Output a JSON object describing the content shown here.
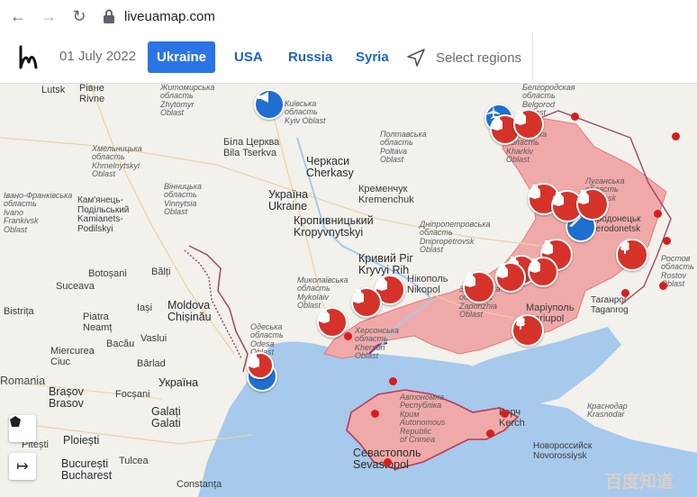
{
  "browser": {
    "url": "liveuamap.com"
  },
  "header": {
    "date": "01 July 2022",
    "tabs": [
      {
        "label": "Ukraine",
        "active": true
      },
      {
        "label": "USA",
        "active": false
      },
      {
        "label": "Russia",
        "active": false
      },
      {
        "label": "Syria",
        "active": false
      }
    ],
    "select_regions": "Select regions"
  },
  "map": {
    "occupied_color": "#f0a9a9",
    "sea_color": "#a6c9ec",
    "labels": {
      "lutsk": "Lutsk",
      "rivne": "Рівне\nRivne",
      "zhytomyr": "Житомирська\nобласть\nZhytomyr\nOblast",
      "kyiv_oblast": "Київська\nобласть\nKyiv Oblast",
      "bila_tserkva": "Біла Церква\nBila Tserkva",
      "khmelnytskyi": "Хмельницька\nобласть\nKhmelnytskyi\nOblast",
      "poltava": "Полтавська\nобласть\nPoltava\nOblast",
      "cherkasy": "Черкаси\nCherkasy",
      "kharkiv": "Харківська\nобласть\nKharkiv\nOblast",
      "belgorod": "Белгородская\nобласть\nBelgorod\nOblast",
      "ivano_frankivsk": "Івано-Франківська\nобласть\nIvano\nFrankivsk\nOblast",
      "kamianets": "Кам'янець-\nПодільський\nKamianets-\nPodilskyi",
      "vinnytsia": "Вінницька\nобласть\nVinnytsia\nOblast",
      "ukraine": "Україна\nUkraine",
      "kremenchuk": "Кременчук\nKremenchuk",
      "kropyvnytskyi": "Кропивницький\nKropyvnytskyi",
      "dnipro": "Дніпропетровська\nобласть\nDnipropetrovsk\nOblast",
      "luhansk": "Луганська\nобласть\nLuhansk\nOblast",
      "sievierodonetsk": "Сєвєродонецьк\nSievierodonetsk",
      "kryvyi_rih": "Кривий Ріг\nKryvyi Rih",
      "nikopol": "Нікополь\nNikopol",
      "zaporizhia": "Запорізька\nобласть\nZaporizhia\nOblast",
      "mykolaiv": "Миколаївська\nобласть\nMykolaiv\nOblast",
      "botosani": "Botoșani",
      "balti": "Bălți",
      "suceava": "Suceava",
      "moldova": "Moldova\nChișinău",
      "iasi": "Iași",
      "piatra": "Piatra\nNeamț",
      "bacau": "Bacău",
      "vaslui": "Vaslui",
      "bistrita": "Bistrița",
      "odesa": "Одеська\nобласть\nOdesa\nOblast",
      "kherson": "Херсонська\nобласть\nKherson\nOblast",
      "mariupol": "Маріуполь\nMariupol",
      "taganrog": "Таганрог\nTaganrog",
      "rostov": "Ростов\nобласть\nRostov\nOblast",
      "miercurea": "Miercurea\nCiuc",
      "barlad": "Bârlad",
      "romania": "Romania",
      "brasov": "Brașov\nBrasov",
      "focsani": "Focșani",
      "ukraine_city": "Україна",
      "crimea": "Автономна\nРеспубліка\nКрим\nAutonomous\nRepublic\nof Crimea",
      "kerch": "Керч\nKerch",
      "krasnodar": "Краснодар\nKrasnodar",
      "novorossiysk": "Новороссийск\nNovorossiysk",
      "galati": "Galați\nGalati",
      "ploiesti": "Ploiești",
      "pitesti": "Pitești",
      "bucuresti": "București\nBucharest",
      "constanta": "Constanța",
      "sevastopol": "Севастополь\nSevastopol",
      "tulcea": "Tulcea"
    }
  },
  "watermark": "百度知道"
}
